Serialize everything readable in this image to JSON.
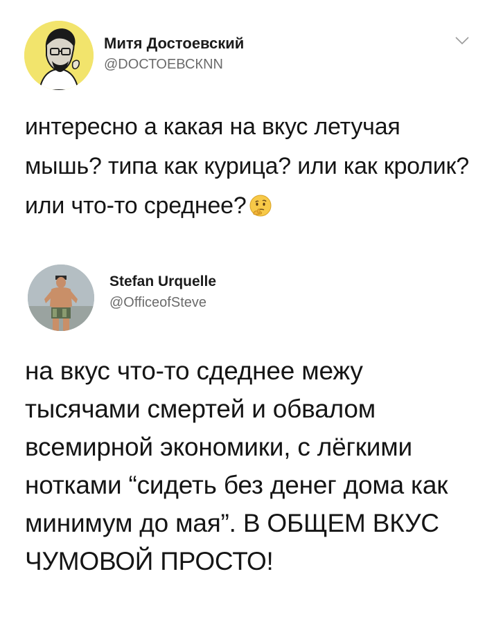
{
  "tweets": [
    {
      "author_name": "Митя Достоевский",
      "author_handle": "@DОСТОЕВСКNN",
      "text": "интересно а какая на вкус летучая мышь? типа как курица? или как кролик? или что-то среднее?",
      "emoji": "thinking-face-emoji"
    },
    {
      "author_name": "Stefan Urquelle",
      "author_handle": "@OfficeofSteve",
      "text": "на вкус что-то сдеднее межу тысячами смертей и обвалом всемирной экономики, с лёгкими нотками “сидеть без денег дома как минимум до мая”. В ОБЩЕМ ВКУС ЧУМОВОЙ ПРОСТО!"
    }
  ],
  "icons": {
    "menu": "chevron-down-icon",
    "avatar1": "man-with-glasses-illustration",
    "avatar2": "shirtless-man-photo"
  }
}
